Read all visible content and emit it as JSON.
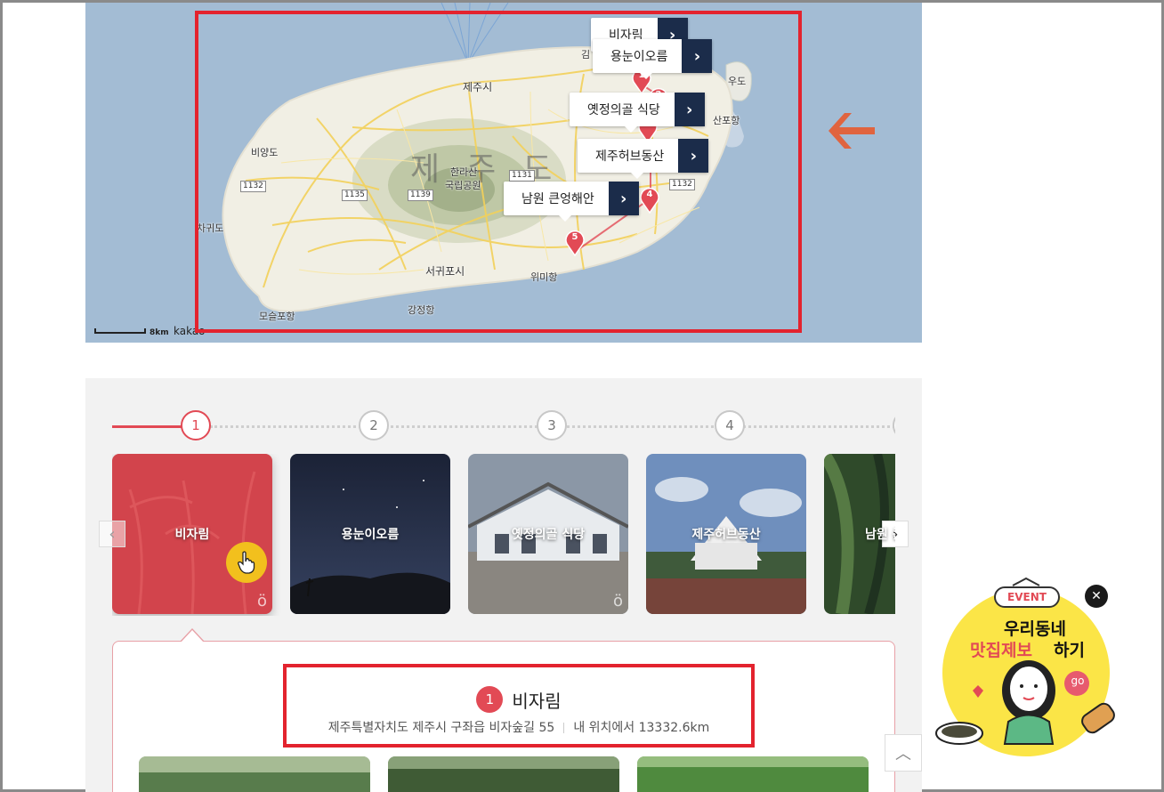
{
  "map": {
    "city_labels": [
      "제주시",
      "서귀포시"
    ],
    "island_label": "제주도",
    "park_label_1": "한라산",
    "park_label_2": "국립공원",
    "place_labels": [
      "비양도",
      "차귀도",
      "모슬포항",
      "강정항",
      "위미항",
      "우도",
      "산포항",
      "김"
    ],
    "route_numbers": [
      "1132",
      "1135",
      "1139",
      "1131",
      "1132"
    ],
    "scale_text": "8km",
    "provider": "kakao",
    "popups": [
      "비자림",
      "용눈이오름",
      "옛정의골 식당",
      "제주허브동산",
      "남원 큰엉해안"
    ],
    "marker_numbers": [
      "1",
      "2",
      "3",
      "4",
      "5"
    ]
  },
  "stepper": {
    "steps": [
      "1",
      "2",
      "3",
      "4"
    ],
    "active_index": 0
  },
  "cards": [
    {
      "label": "비자림"
    },
    {
      "label": "용눈이오름"
    },
    {
      "label": "옛정의골 식당"
    },
    {
      "label": "제주허브동산"
    },
    {
      "label": "남원 큰엉해안"
    }
  ],
  "detail": {
    "number": "1",
    "name": "비자림",
    "address": "제주특별자치도 제주시 구좌읍 비자숲길 55",
    "distance": "내 위치에서 13332.6km"
  },
  "event": {
    "badge": "EVENT",
    "line1": "우리동네",
    "line2a": "맛집제보",
    "line2b": "하기",
    "go": "go"
  },
  "colors": {
    "accent": "#e24a55",
    "highlight": "#e3232e",
    "navy": "#1b2c4a",
    "arrow": "#e0643f"
  },
  "icons": {
    "next": "chevron-right-icon",
    "prev": "chevron-left-icon",
    "top": "chevron-up-icon",
    "close": "close-icon",
    "cursor": "hand-pointer-icon"
  }
}
